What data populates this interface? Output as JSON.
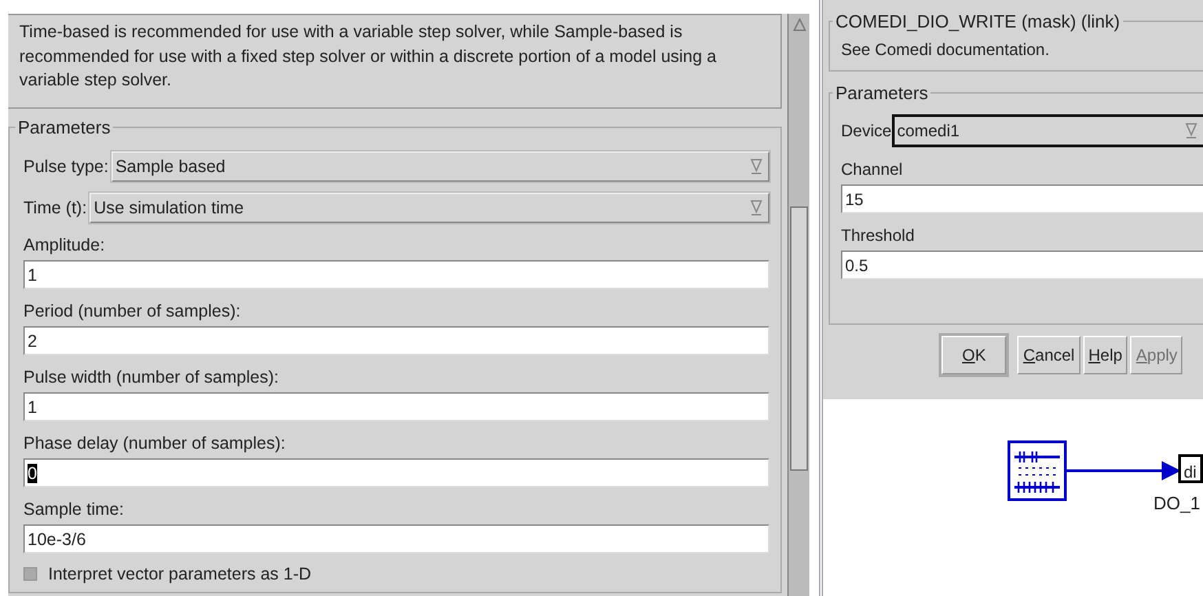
{
  "block_dialog": {
    "description": "Time-based is recommended for use with a variable step solver, while Sample-based is recommended for use with a fixed step solver or within a discrete portion of a model using a variable step solver.",
    "parameters": {
      "title": "Parameters",
      "fields": [
        {
          "kind": "dropdown",
          "label": "Pulse type:",
          "value": "Sample based"
        },
        {
          "kind": "dropdown",
          "label": "Time (t):",
          "value": "Use simulation time"
        },
        {
          "kind": "text",
          "label": "Amplitude:",
          "value": "1",
          "focused": false
        },
        {
          "kind": "text",
          "label": "Period (number of samples):",
          "value": "2",
          "focused": false
        },
        {
          "kind": "text",
          "label": "Pulse width (number of samples):",
          "value": "1",
          "focused": false
        },
        {
          "kind": "text",
          "label": "Phase delay (number of samples):",
          "value": "0",
          "focused": true
        },
        {
          "kind": "text",
          "label": "Sample time:",
          "value": "10e-3/6",
          "focused": false
        },
        {
          "kind": "checkbox",
          "label": "Interpret vector parameters as 1-D",
          "checked": false
        }
      ]
    }
  },
  "mask_dialog": {
    "title": "COMEDI_DIO_WRITE (mask) (link)",
    "description": "See Comedi documentation.",
    "parameters": {
      "title": "Parameters",
      "fields": [
        {
          "kind": "dropdown",
          "label": "Device",
          "value": "comedi1",
          "focused": true
        },
        {
          "kind": "text",
          "label": "Channel",
          "value": "15"
        },
        {
          "kind": "text",
          "label": "Threshold",
          "value": "0.5"
        }
      ]
    },
    "buttons": [
      {
        "label": "OK",
        "disabled": false
      },
      {
        "label": "Cancel",
        "disabled": false
      },
      {
        "label": "Help",
        "disabled": false
      },
      {
        "label": "Apply",
        "disabled": true
      }
    ]
  },
  "diagram": {
    "target_block": {
      "icon_text": "di",
      "label": "DO_1"
    }
  }
}
